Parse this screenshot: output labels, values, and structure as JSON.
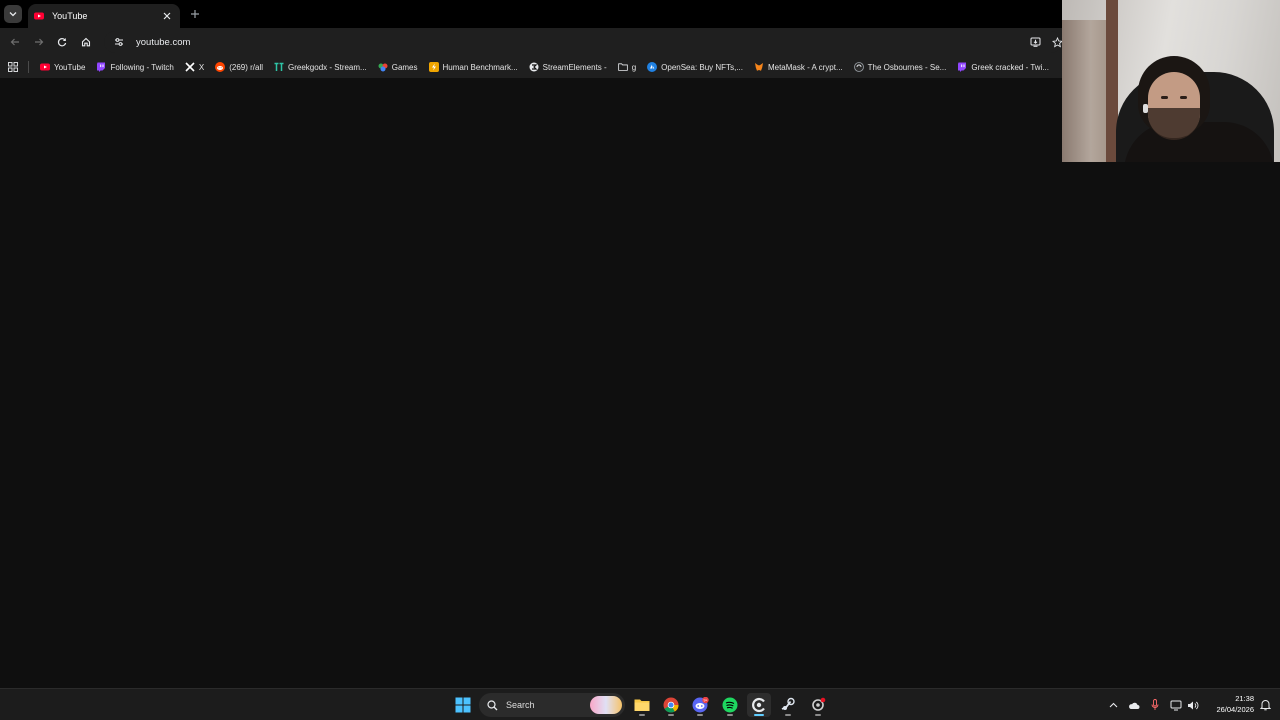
{
  "browser": {
    "tab": {
      "title": "YouTube"
    },
    "url": "youtube.com",
    "bookmarks": [
      {
        "label": "YouTube",
        "icon": "youtube-icon"
      },
      {
        "label": "Following - Twitch",
        "icon": "twitch-icon"
      },
      {
        "label": "X",
        "icon": "x-icon"
      },
      {
        "label": "(269) r/all",
        "icon": "reddit-icon"
      },
      {
        "label": "Greekgodx - Stream...",
        "icon": "tt-icon"
      },
      {
        "label": "Games",
        "icon": "games-icon"
      },
      {
        "label": "Human Benchmark...",
        "icon": "lightning-icon"
      },
      {
        "label": "StreamElements -",
        "icon": "streamelements-icon"
      },
      {
        "label": "g",
        "icon": "folder-icon"
      },
      {
        "label": "OpenSea: Buy NFTs,...",
        "icon": "opensea-icon"
      },
      {
        "label": "MetaMask - A crypt...",
        "icon": "metamask-icon"
      },
      {
        "label": "The Osbournes - Se...",
        "icon": "circle-site-icon"
      },
      {
        "label": "Greek cracked - Twi...",
        "icon": "twitch-icon"
      }
    ]
  },
  "taskbar": {
    "search_label": "Search",
    "clock": {
      "time": "21:38",
      "date": "26/04/2026"
    },
    "discord_badge": "9+"
  },
  "colors": {
    "page_bg": "#0f0f0f",
    "toolbar_bg": "#1f1f1f",
    "accent": "#60cdff",
    "youtube_red": "#ff0033",
    "twitch_purple": "#9146ff"
  }
}
